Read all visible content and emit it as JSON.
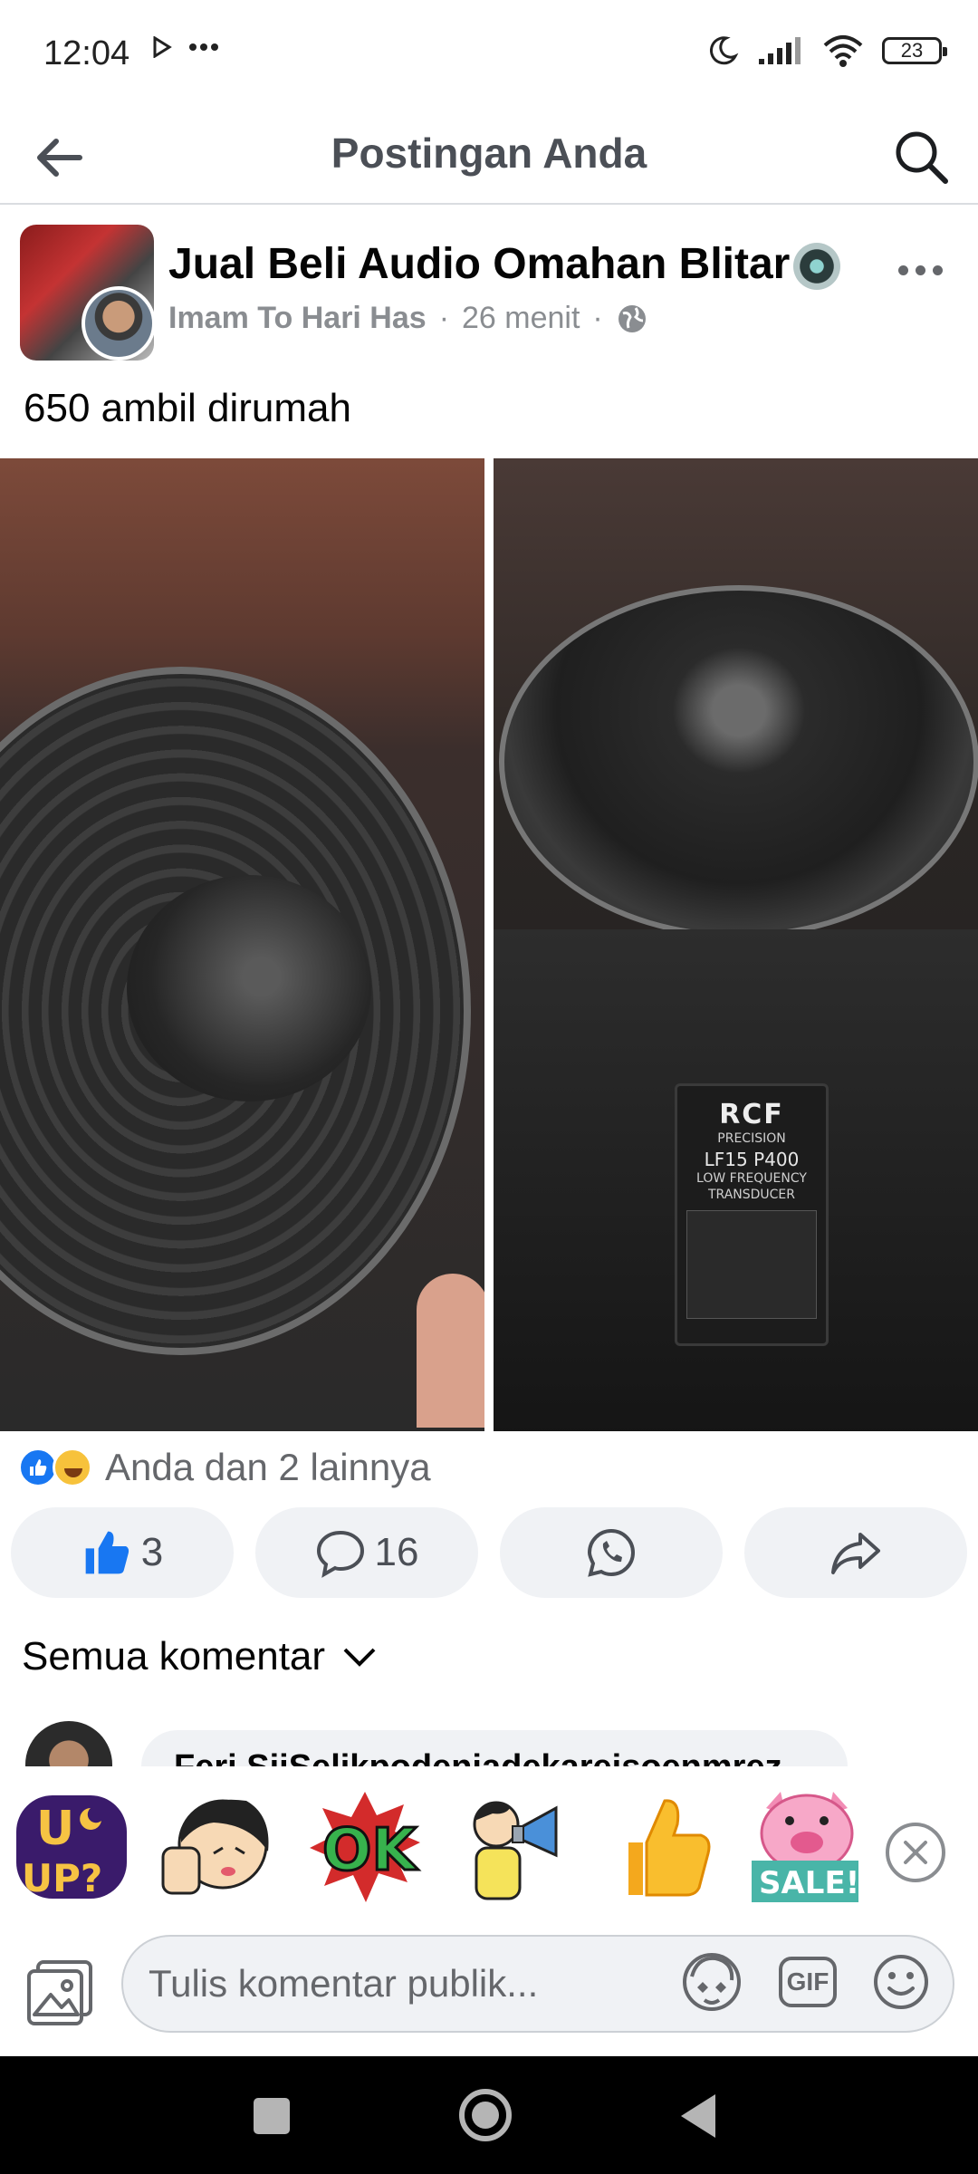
{
  "status_bar": {
    "time": "12:04",
    "battery": "23"
  },
  "header": {
    "title": "Postingan Anda"
  },
  "post": {
    "group_name": "Jual Beli Audio Omahan Blitar",
    "author": "Imam To Hari Has",
    "separator": "·",
    "time_ago": "26 menit",
    "text": "650 ambil dirumah",
    "photo_label": {
      "brand": "RCF",
      "line1": "PRECISION",
      "model": "LF15 P400",
      "line2": "LOW FREQUENCY",
      "line3": "TRANSDUCER"
    }
  },
  "reactions": {
    "text": "Anda dan 2 lainnya"
  },
  "actions": {
    "like_count": "3",
    "comment_count": "16"
  },
  "comments": {
    "filter_label": "Semua komentar",
    "peek_author": "Feri SijSelikpodenjadekareisoenmrez"
  },
  "composer": {
    "placeholder": "Tulis komentar publik...",
    "gif_label": "GIF"
  },
  "stickers": [
    {
      "name": "u-up-sticker",
      "text": "UP?"
    },
    {
      "name": "thumbs-girl-sticker",
      "text": ""
    },
    {
      "name": "ok-sticker",
      "text": "OK"
    },
    {
      "name": "megaphone-sticker",
      "text": ""
    },
    {
      "name": "thumbs-up-sticker",
      "text": ""
    },
    {
      "name": "sale-pig-sticker",
      "text": "SALE!"
    }
  ],
  "colors": {
    "accent": "#1877f2",
    "text_primary": "#050505",
    "text_secondary": "#65676b",
    "button_bg": "#f0f2f5"
  }
}
